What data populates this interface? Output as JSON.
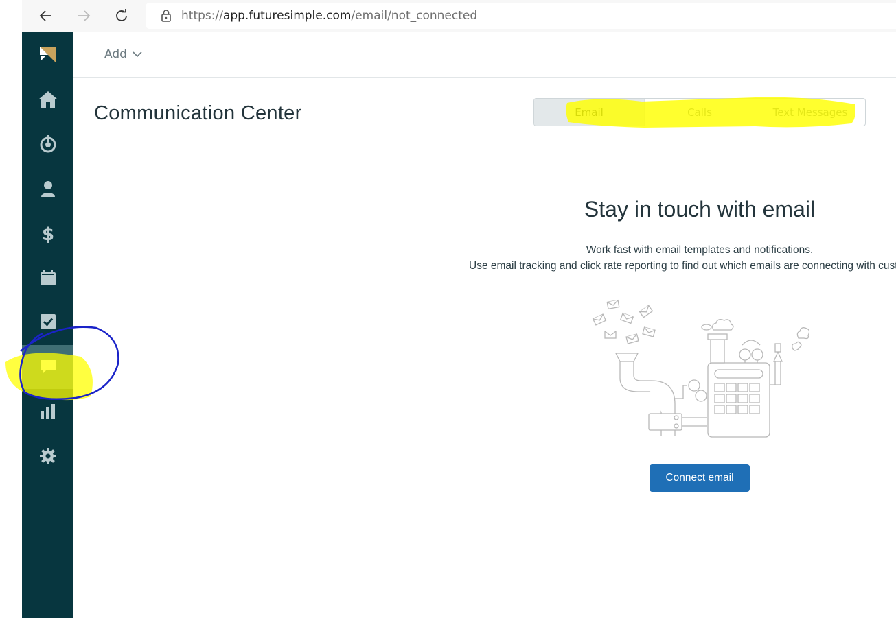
{
  "browser": {
    "url_prefix": "https://",
    "url_host": "app.futuresimple.com",
    "url_path": "/email/not_connected",
    "icons": [
      "back-arrow-icon",
      "forward-arrow-icon",
      "reload-icon",
      "lock-icon"
    ]
  },
  "sidebar": {
    "items": [
      {
        "name": "logo",
        "icon": "logo-icon"
      },
      {
        "name": "home",
        "icon": "home-icon"
      },
      {
        "name": "leads",
        "icon": "target-icon"
      },
      {
        "name": "contacts",
        "icon": "person-icon"
      },
      {
        "name": "deals",
        "icon": "dollar-icon"
      },
      {
        "name": "calendar",
        "icon": "calendar-icon"
      },
      {
        "name": "tasks",
        "icon": "checkbox-icon"
      },
      {
        "name": "communication",
        "icon": "chat-bubble-icon",
        "active": true
      },
      {
        "name": "reports",
        "icon": "bar-chart-icon"
      },
      {
        "name": "settings",
        "icon": "gear-icon"
      }
    ],
    "colors": {
      "background": "#07363f",
      "active": "#3f6e74",
      "icon": "#b9cbcf"
    }
  },
  "topbar": {
    "add_label": "Add"
  },
  "header": {
    "title": "Communication Center",
    "tabs": [
      {
        "label": "Email",
        "selected": true
      },
      {
        "label": "Calls"
      },
      {
        "label": "Text Messages"
      }
    ]
  },
  "main": {
    "title": "Stay in touch with email",
    "line1": "Work fast with email templates and notifications.",
    "line2": "Use email tracking and click rate reporting to find out which emails are connecting with customers.",
    "button_label": "Connect email",
    "accent": "#1f6fb6"
  }
}
